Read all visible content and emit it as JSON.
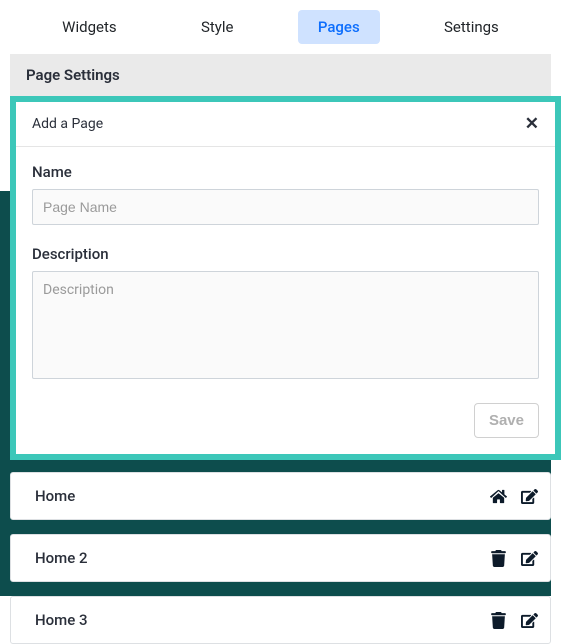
{
  "tabs": {
    "widgets": "Widgets",
    "style": "Style",
    "pages": "Pages",
    "settings": "Settings"
  },
  "section_title": "Page Settings",
  "add_page": {
    "title": "Add a Page",
    "name_label": "Name",
    "name_placeholder": "Page Name",
    "description_label": "Description",
    "description_placeholder": "Description",
    "save_label": "Save"
  },
  "pages": [
    {
      "name": "Home",
      "is_home": true
    },
    {
      "name": "Home 2",
      "is_home": false
    },
    {
      "name": "Home 3",
      "is_home": false
    }
  ]
}
